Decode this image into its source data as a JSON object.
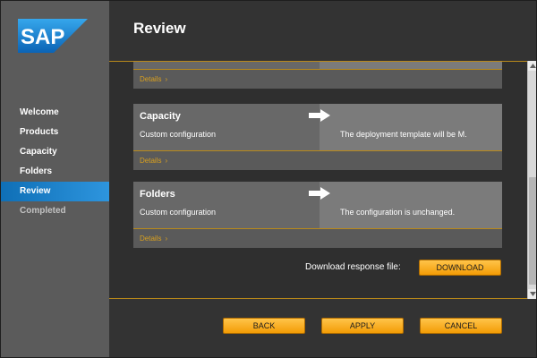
{
  "app": {
    "logo_text": "SAP",
    "brand_color": "#1a8ad6",
    "accent_color": "#f5a300"
  },
  "sidebar": {
    "items": [
      {
        "label": "Welcome",
        "state": "done"
      },
      {
        "label": "Products",
        "state": "done"
      },
      {
        "label": "Capacity",
        "state": "done"
      },
      {
        "label": "Folders",
        "state": "done"
      },
      {
        "label": "Review",
        "state": "active"
      },
      {
        "label": "Completed",
        "state": "disabled"
      }
    ]
  },
  "header": {
    "title": "Review"
  },
  "review": {
    "details_label": "Details",
    "chevron": "›",
    "sections": [
      {
        "title": "Capacity",
        "subtitle": "Custom configuration",
        "result": "The deployment template will be M."
      },
      {
        "title": "Folders",
        "subtitle": "Custom configuration",
        "result": "The configuration is unchanged."
      }
    ],
    "download_label": "Download response file:",
    "download_button": "DOWNLOAD"
  },
  "footer": {
    "back_label": "BACK",
    "apply_label": "APPLY",
    "cancel_label": "CANCEL"
  },
  "icons": {
    "arrow": "right-arrow-icon",
    "scroll_up": "scroll-up-icon",
    "scroll_down": "scroll-down-icon"
  }
}
